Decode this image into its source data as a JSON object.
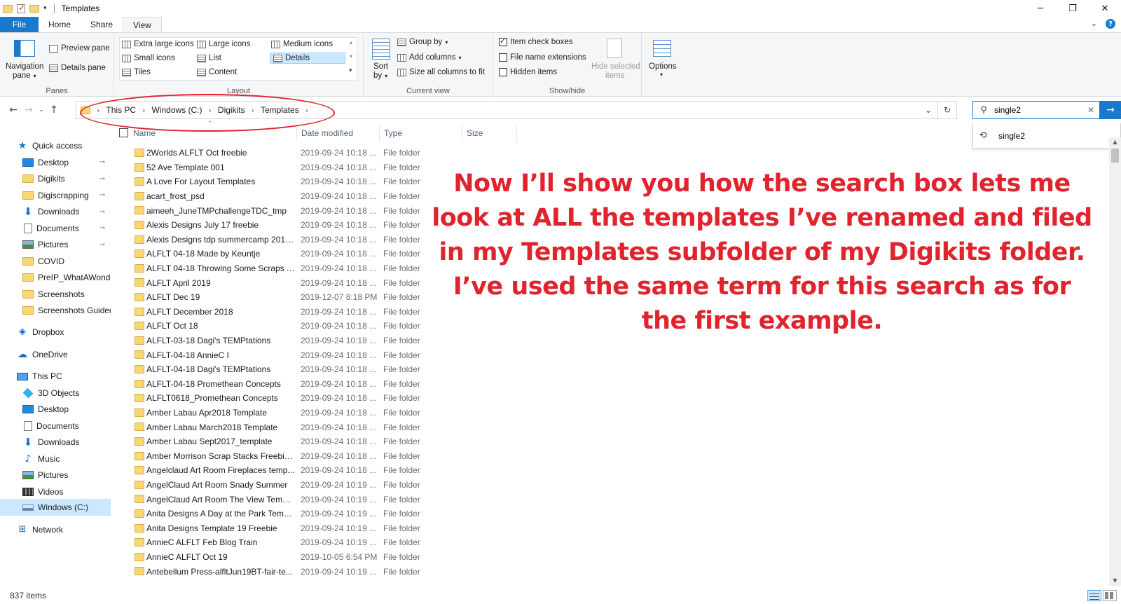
{
  "window": {
    "title": "Templates",
    "minimize": "─",
    "maximize": "❐",
    "close": "✕"
  },
  "tabs": [
    {
      "label": "File"
    },
    {
      "label": "Home"
    },
    {
      "label": "Share"
    },
    {
      "label": "View"
    }
  ],
  "ribbon": {
    "panes": {
      "label": "Panes",
      "navigation_pane": "Navigation",
      "navigation_pane2": "pane",
      "preview_pane": "Preview pane",
      "details_pane": "Details pane"
    },
    "layout": {
      "label": "Layout",
      "items": [
        "Extra large icons",
        "Large icons",
        "Medium icons",
        "Small icons",
        "List",
        "Details",
        "Tiles",
        "Content"
      ]
    },
    "current_view": {
      "label": "Current view",
      "sort_by": "Sort",
      "sort_by2": "by",
      "group_by": "Group by",
      "add_columns": "Add columns",
      "size_all_columns": "Size all columns to fit"
    },
    "show_hide": {
      "label": "Show/hide",
      "item_check_boxes": "Item check boxes",
      "file_name_extensions": "File name extensions",
      "hidden_items": "Hidden items",
      "hide_selected": "Hide selected",
      "hide_selected2": "items"
    },
    "options": "Options"
  },
  "address": {
    "crumbs": [
      "This PC",
      "Windows (C:)",
      "Digikits",
      "Templates"
    ]
  },
  "search": {
    "value": "single2",
    "suggestion": "single2"
  },
  "sidebar": {
    "items": [
      {
        "label": "Quick access",
        "icon": "star-icon"
      },
      {
        "label": "Desktop",
        "icon": "desktop-icon",
        "pinned": true
      },
      {
        "label": "Digikits",
        "icon": "folder-icon",
        "pinned": true
      },
      {
        "label": "Digiscrapping",
        "icon": "folder-icon",
        "pinned": true
      },
      {
        "label": "Downloads",
        "icon": "download-icon",
        "pinned": true
      },
      {
        "label": "Documents",
        "icon": "document-icon",
        "pinned": true
      },
      {
        "label": "Pictures",
        "icon": "pictures-icon",
        "pinned": true
      },
      {
        "label": "COVID",
        "icon": "folder-icon"
      },
      {
        "label": "PreIP_WhatAWonde",
        "icon": "folder-icon"
      },
      {
        "label": "Screenshots",
        "icon": "folder-icon"
      },
      {
        "label": "Screenshots Guided",
        "icon": "folder-icon"
      },
      {
        "label": "Dropbox",
        "icon": "dropbox-icon"
      },
      {
        "label": "OneDrive",
        "icon": "cloud-icon"
      },
      {
        "label": "This PC",
        "icon": "computer-icon"
      },
      {
        "label": "3D Objects",
        "icon": "cube-icon"
      },
      {
        "label": "Desktop",
        "icon": "desktop-icon"
      },
      {
        "label": "Documents",
        "icon": "document-icon"
      },
      {
        "label": "Downloads",
        "icon": "download-icon"
      },
      {
        "label": "Music",
        "icon": "music-icon"
      },
      {
        "label": "Pictures",
        "icon": "pictures-icon"
      },
      {
        "label": "Videos",
        "icon": "video-icon"
      },
      {
        "label": "Windows (C:)",
        "icon": "drive-icon"
      },
      {
        "label": "Network",
        "icon": "network-icon"
      }
    ]
  },
  "columns": [
    "Name",
    "Date modified",
    "Type",
    "Size"
  ],
  "files": [
    {
      "name": "2Worlds ALFLT Oct freebie",
      "date": "2019-09-24 10:18 ...",
      "type": "File folder"
    },
    {
      "name": "52 Ave Template 001",
      "date": "2019-09-24 10:18 ...",
      "type": "File folder"
    },
    {
      "name": "A Love For Layout Templates",
      "date": "2019-09-24 10:18 ...",
      "type": "File folder"
    },
    {
      "name": "acart_frost_psd",
      "date": "2019-09-24 10:18 ...",
      "type": "File folder"
    },
    {
      "name": "aimeeh_JuneTMPchallengeTDC_tmp",
      "date": "2019-09-24 10:18 ...",
      "type": "File folder"
    },
    {
      "name": "Alexis Designs July 17 freebie",
      "date": "2019-09-24 10:18 ...",
      "type": "File folder"
    },
    {
      "name": "Alexis Designs tdp summercamp 2017...",
      "date": "2019-09-24 10:18 ...",
      "type": "File folder"
    },
    {
      "name": "ALFLT 04-18 Made by Keuntje",
      "date": "2019-09-24 10:18 ...",
      "type": "File folder"
    },
    {
      "name": "ALFLT 04-18 Throwing Some Scraps Ar...",
      "date": "2019-09-24 10:18 ...",
      "type": "File folder"
    },
    {
      "name": "ALFLT April 2019",
      "date": "2019-09-24 10:18 ...",
      "type": "File folder"
    },
    {
      "name": "ALFLT Dec 19",
      "date": "2019-12-07 8:18 PM",
      "type": "File folder"
    },
    {
      "name": "ALFLT December 2018",
      "date": "2019-09-24 10:18 ...",
      "type": "File folder"
    },
    {
      "name": "ALFLT Oct 18",
      "date": "2019-09-24 10:18 ...",
      "type": "File folder"
    },
    {
      "name": "ALFLT-03-18 Dagi's TEMPtations",
      "date": "2019-09-24 10:18 ...",
      "type": "File folder"
    },
    {
      "name": "ALFLT-04-18 AnnieC I",
      "date": "2019-09-24 10:18 ...",
      "type": "File folder"
    },
    {
      "name": "ALFLT-04-18 Dagi's TEMPtations",
      "date": "2019-09-24 10:18 ...",
      "type": "File folder"
    },
    {
      "name": "ALFLT-04-18 Promethean Concepts",
      "date": "2019-09-24 10:18 ...",
      "type": "File folder"
    },
    {
      "name": "ALFLT0618_Promethean Concepts",
      "date": "2019-09-24 10:18 ...",
      "type": "File folder"
    },
    {
      "name": "Amber Labau Apr2018 Template",
      "date": "2019-09-24 10:18 ...",
      "type": "File folder"
    },
    {
      "name": "Amber Labau March2018 Template",
      "date": "2019-09-24 10:18 ...",
      "type": "File folder"
    },
    {
      "name": "Amber Labau Sept2017_template",
      "date": "2019-09-24 10:18 ...",
      "type": "File folder"
    },
    {
      "name": "Amber Morrison Scrap Stacks Freebie ...",
      "date": "2019-09-24 10:18 ...",
      "type": "File folder"
    },
    {
      "name": "Angelclaud Art Room Fireplaces temp...",
      "date": "2019-09-24 10:18 ...",
      "type": "File folder"
    },
    {
      "name": "AngelClaud Art Room Snady Summer",
      "date": "2019-09-24 10:19 ...",
      "type": "File folder"
    },
    {
      "name": "AngelClaud Art Room The View Templ...",
      "date": "2019-09-24 10:19 ...",
      "type": "File folder"
    },
    {
      "name": "Anita Designs A Day at the Park Templ...",
      "date": "2019-09-24 10:19 ...",
      "type": "File folder"
    },
    {
      "name": "Anita Designs Template 19 Freebie",
      "date": "2019-09-24 10:19 ...",
      "type": "File folder"
    },
    {
      "name": "AnnieC ALFLT Feb Blog Train",
      "date": "2019-09-24 10:19 ...",
      "type": "File folder"
    },
    {
      "name": "AnnieC ALFLT Oct  19",
      "date": "2019-10-05 6:54 PM",
      "type": "File folder"
    },
    {
      "name": "Antebellum Press-alfltJun19BT-fair-te...",
      "date": "2019-09-24 10:19 ...",
      "type": "File folder"
    }
  ],
  "annotation": "Now I’ll show you how the search box lets me look at ALL the templates I’ve renamed and filed in my Templates subfolder of my Digikits folder. I’ve used the same term for this search as for the first example.",
  "status": {
    "item_count": "837 items"
  },
  "colors": {
    "accent": "#1979ca",
    "annotation_red": "#e0232d",
    "selection": "#cce8ff"
  }
}
